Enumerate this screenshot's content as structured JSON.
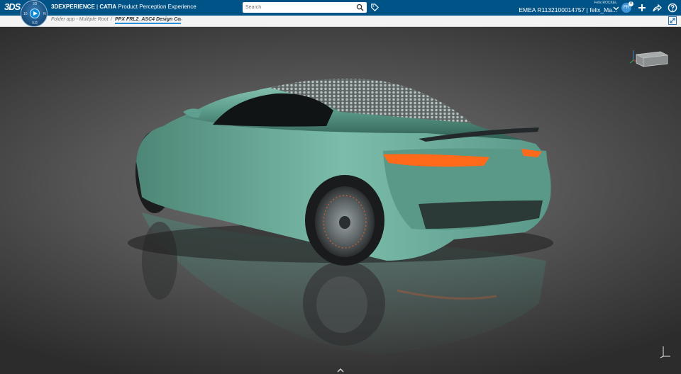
{
  "header": {
    "brand": "3DS",
    "app_title_prefix": "3DEXPERIENCE",
    "app_title_separator": " | ",
    "app_title_product": "CATIA",
    "app_title_suffix": " Product Perception Experience",
    "search_placeholder": "Search",
    "user_name": "Felix ROCKEL",
    "user_context": "EMEA R1132100014757 | felix_Ma...",
    "avatar_initials": "FR",
    "avatar_badge": "8",
    "icons": [
      "search-icon",
      "tag-icon",
      "chevron-down-icon",
      "plus-icon",
      "share-icon",
      "help-icon"
    ]
  },
  "compass": {
    "top": "3D",
    "bottom": "V.R",
    "left": "10",
    "right": "N"
  },
  "tabs": {
    "items": [
      {
        "label": "Folder app - Multiple Root"
      },
      {
        "label": "/"
      },
      {
        "label": "PPX FRL2_ASC4 Design Co"
      }
    ],
    "add_label": "+"
  },
  "viewport": {
    "description_icons": [
      "view-cube-icon",
      "axis-triad-icon",
      "fullscreen-icon"
    ],
    "colors": {
      "car_body": "#5d9e8e",
      "taillight": "#ff6a1a",
      "background": "#555555"
    }
  }
}
